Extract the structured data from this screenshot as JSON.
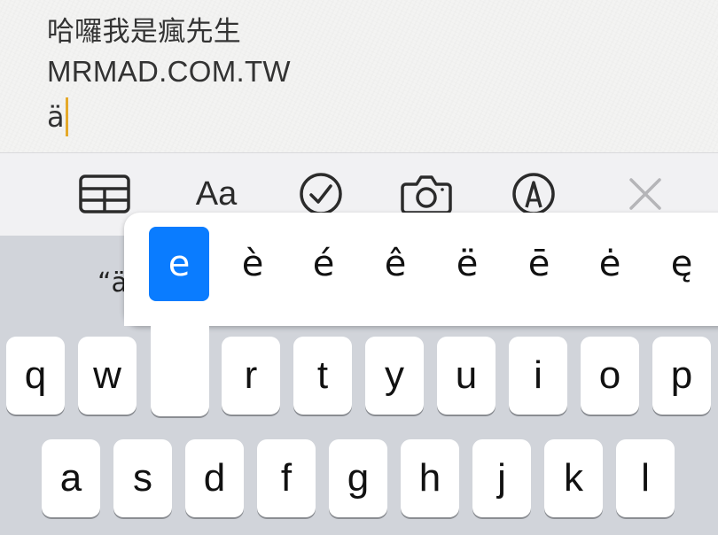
{
  "note": {
    "lines": [
      "哈囉我是瘋先生",
      "MRMAD.COM.TW",
      "ä"
    ]
  },
  "toolbar": {
    "aa_label": "Aa",
    "icons": [
      "table-icon",
      "text-format-icon",
      "checklist-icon",
      "camera-icon",
      "markup-pen-icon",
      "close-icon"
    ]
  },
  "keyboard": {
    "suggestion": "“ä",
    "row1": [
      "q",
      "w",
      "e",
      "r",
      "t",
      "y",
      "u",
      "i",
      "o",
      "p"
    ],
    "row2": [
      "a",
      "s",
      "d",
      "f",
      "g",
      "h",
      "j",
      "k",
      "l"
    ]
  },
  "accent_popup": {
    "options": [
      "e",
      "è",
      "é",
      "ê",
      "ë",
      "ē",
      "ė",
      "ę"
    ],
    "selected": "e"
  },
  "colors": {
    "caret": "#e5a92a",
    "selected_accent": "#0a7cff",
    "keyboard_bg": "#d1d4da",
    "key_bg": "#ffffff"
  }
}
